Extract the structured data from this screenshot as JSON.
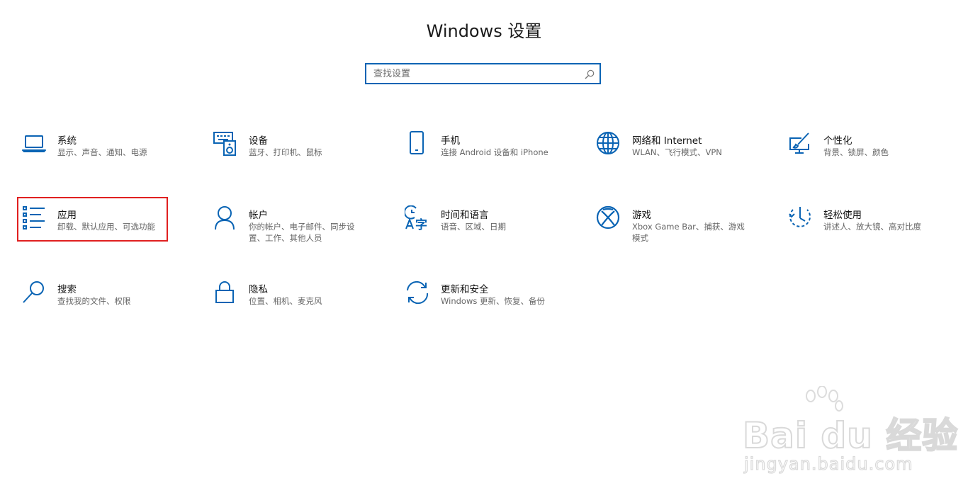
{
  "window": {
    "title": "Windows 设置"
  },
  "search": {
    "placeholder": "查找设置",
    "icon": "search-icon"
  },
  "accent_color": "#0a64b4",
  "highlight_color": "#e02020",
  "tiles": [
    {
      "title": "系统",
      "desc": "显示、声音、通知、电源",
      "icon": "laptop-icon"
    },
    {
      "title": "设备",
      "desc": "蓝牙、打印机、鼠标",
      "icon": "keyboard-speaker-icon"
    },
    {
      "title": "手机",
      "desc": "连接 Android 设备和 iPhone",
      "icon": "phone-icon"
    },
    {
      "title": "网络和 Internet",
      "desc": "WLAN、飞行模式、VPN",
      "icon": "globe-icon"
    },
    {
      "title": "个性化",
      "desc": "背景、锁屏、颜色",
      "icon": "paint-monitor-icon"
    },
    {
      "title": "应用",
      "desc": "卸载、默认应用、可选功能",
      "icon": "apps-list-icon"
    },
    {
      "title": "帐户",
      "desc": "你的帐户、电子邮件、同步设置、工作、其他人员",
      "icon": "person-icon"
    },
    {
      "title": "时间和语言",
      "desc": "语音、区域、日期",
      "icon": "time-language-icon"
    },
    {
      "title": "游戏",
      "desc": "Xbox Game Bar、捕获、游戏模式",
      "icon": "xbox-icon"
    },
    {
      "title": "轻松使用",
      "desc": "讲述人、放大镜、高对比度",
      "icon": "ease-of-access-icon"
    },
    {
      "title": "搜索",
      "desc": "查找我的文件、权限",
      "icon": "search-icon"
    },
    {
      "title": "隐私",
      "desc": "位置、相机、麦克风",
      "icon": "lock-icon"
    },
    {
      "title": "更新和安全",
      "desc": "Windows 更新、恢复、备份",
      "icon": "refresh-icon"
    }
  ],
  "watermark": {
    "logo": "Bai du 经验",
    "url": "jingyan.baidu.com"
  }
}
